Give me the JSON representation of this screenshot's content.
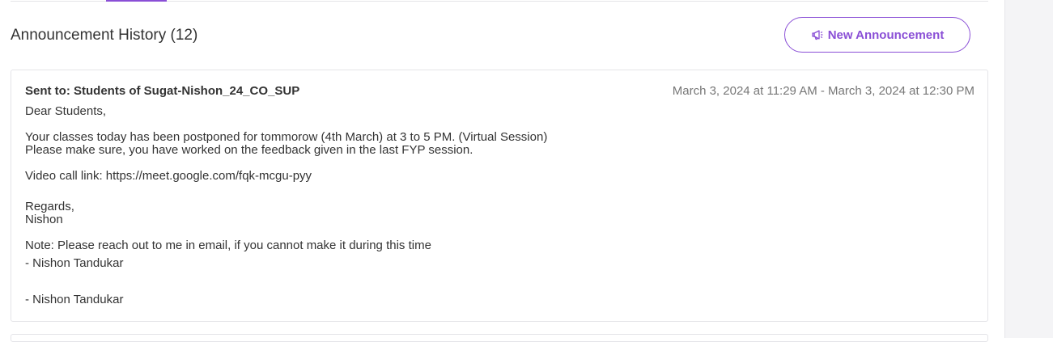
{
  "section": {
    "title": "Announcement History (12)"
  },
  "toolbar": {
    "new_announcement_label": "New Announcement"
  },
  "announcement": {
    "sent_to": "Sent to: Students of Sugat-Nishon_24_CO_SUP",
    "date_range": "March 3, 2024 at 11:29 AM - March 3, 2024 at 12:30 PM",
    "lines": {
      "greeting": "Dear Students,",
      "body1": "Your classes today has been postponed for tommorow (4th March) at 3 to 5 PM. (Virtual Session)",
      "body2": "Please make sure, you have worked on the feedback given in the last FYP session.",
      "video_link": "Video call link: https://meet.google.com/fqk-mcgu-pyy",
      "regards": "Regards,",
      "name": "Nishon",
      "note": "Note: Please reach out to me in email, if you cannot make it during this time",
      "signature1": "- Nishon Tandukar",
      "signature2": "- Nishon Tandukar"
    }
  },
  "colors": {
    "accent": "#8a4fd6",
    "text": "#333333",
    "muted": "#777777",
    "border": "#e4e4e8"
  },
  "icons": {
    "new_button_icon": "megaphone-icon"
  }
}
